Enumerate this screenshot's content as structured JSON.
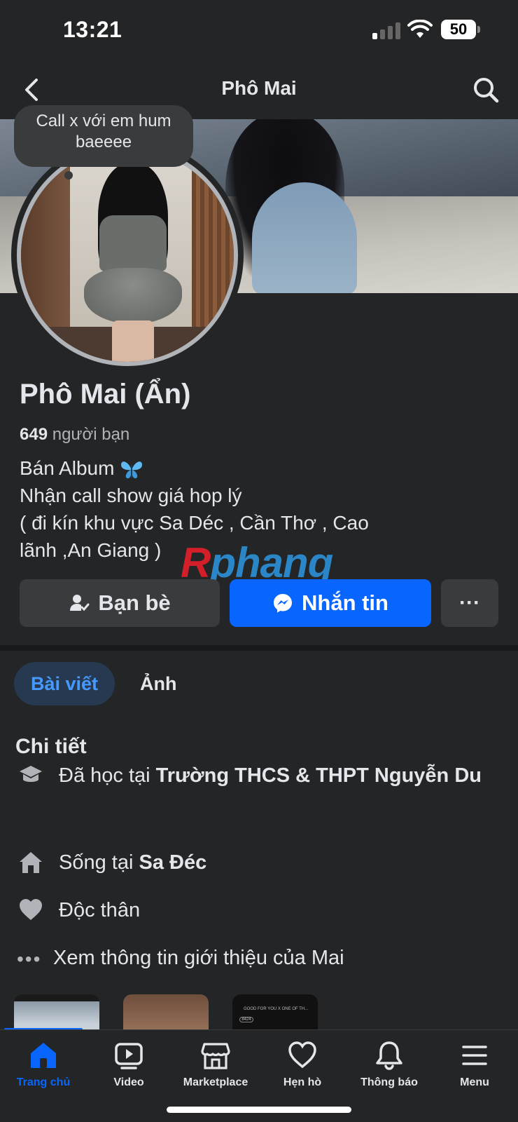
{
  "status_bar": {
    "time": "13:21",
    "battery": "50"
  },
  "navbar": {
    "title": "Phô Mai",
    "back_icon": "chevron-left-icon",
    "search_icon": "search-icon"
  },
  "profile": {
    "note": "Call x với em hum baeeee",
    "name": "Phô Mai (Ẩn)",
    "friends_count": "649",
    "friends_label": "người bạn",
    "bio_lines": [
      "Bán Album",
      "Nhận call show giá hop lý",
      "( đi kín khu vực Sa Déc , Cần Thơ , Cao",
      "lãnh ,An Giang )"
    ],
    "bio_emoji": "butterfly-icon",
    "watermark": "Rphang"
  },
  "actions": {
    "friends_label": "Bạn bè",
    "message_label": "Nhắn tin",
    "more_label": "···"
  },
  "tabs": {
    "posts": "Bài viết",
    "photos": "Ảnh"
  },
  "details": {
    "title": "Chi tiết",
    "education_prefix": "Đã học tại",
    "education_place": "Trường THCS & THPT Nguyễn Du",
    "lives_prefix": "Sống tại",
    "lives_place": "Sa Đéc",
    "relationship": "Độc thân",
    "see_more": "Xem thông tin giới thiệu của Mai"
  },
  "thumbnail_texts": {
    "caption": "GOOD FOR YOU X ONE OF TH...",
    "badge": "8424"
  },
  "tabbar": {
    "items": [
      {
        "label": "Trang chủ",
        "icon": "home-icon",
        "active": true
      },
      {
        "label": "Video",
        "icon": "video-icon",
        "active": false
      },
      {
        "label": "Marketplace",
        "icon": "marketplace-icon",
        "active": false
      },
      {
        "label": "Hẹn hò",
        "icon": "dating-heart-icon",
        "active": false
      },
      {
        "label": "Thông báo",
        "icon": "bell-icon",
        "active": false
      },
      {
        "label": "Menu",
        "icon": "menu-icon",
        "active": false
      }
    ]
  },
  "colors": {
    "background": "#242526",
    "accent": "#0866ff",
    "text": "#e4e6eb"
  }
}
